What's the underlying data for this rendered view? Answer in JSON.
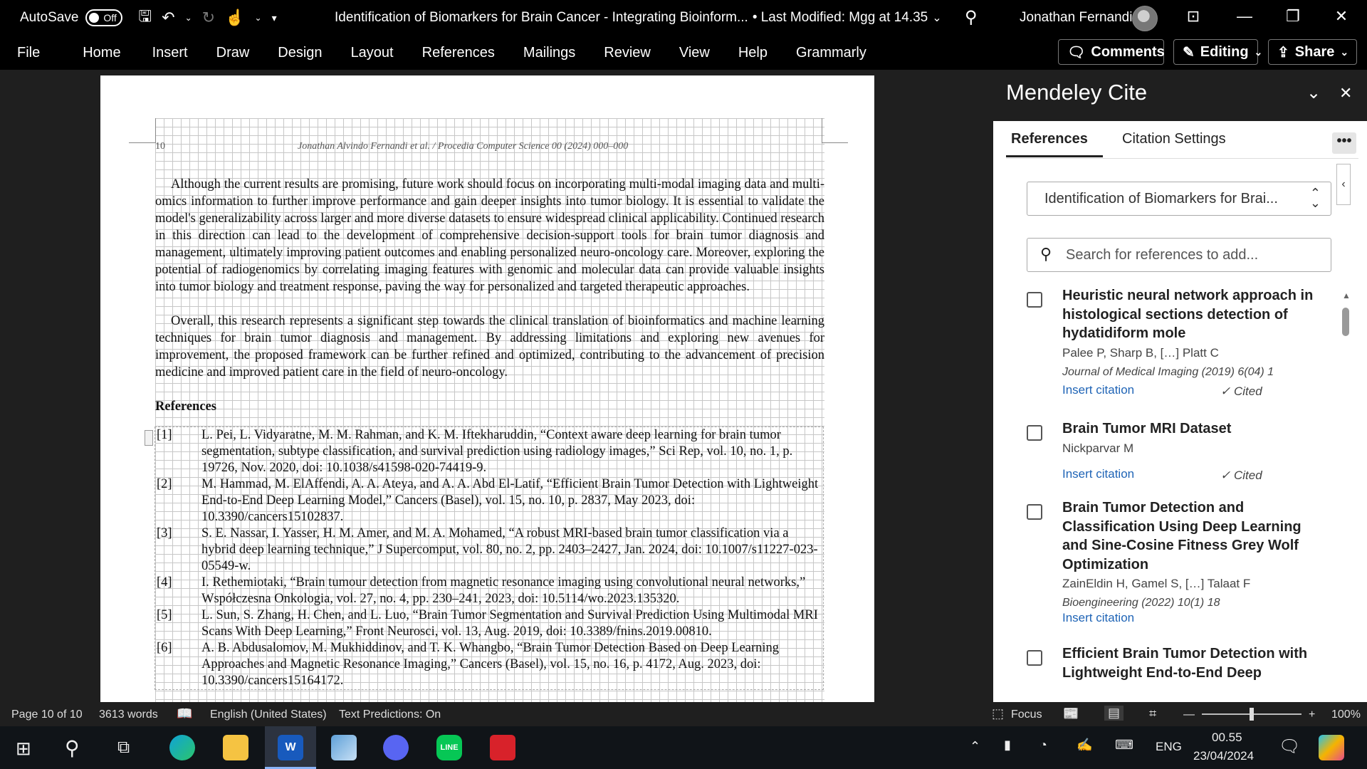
{
  "titlebar": {
    "autosave_label": "AutoSave",
    "autosave_state": "Off",
    "document_title": "Identification of Biomarkers for Brain Cancer - Integrating Bioinform...",
    "modified": "• Last Modified: Mgg at 14.35",
    "user": "Jonathan Fernandi"
  },
  "ribbon": {
    "tabs": [
      "File",
      "Home",
      "Insert",
      "Draw",
      "Design",
      "Layout",
      "References",
      "Mailings",
      "Review",
      "View",
      "Help",
      "Grammarly"
    ],
    "comments": "Comments",
    "editing": "Editing",
    "share": "Share"
  },
  "document": {
    "page_number": "10",
    "running_title": "Jonathan Alvindo Fernandi et al. / Procedia Computer Science 00 (2024) 000–000",
    "paragraph1": "Although the current results are promising, future work should focus on incorporating multi-modal imaging data and multi-omics information to further improve performance and gain deeper insights into tumor biology. It is essential to validate the model's generalizability across larger and more diverse datasets to ensure widespread clinical applicability. Continued research in this direction can lead to the development of comprehensive decision-support tools for brain tumor diagnosis and management, ultimately improving patient outcomes and enabling personalized neuro-oncology care. Moreover, exploring the potential of radiogenomics by correlating imaging features with genomic and molecular data can provide valuable insights into tumor biology and treatment response, paving the way for personalized and targeted therapeutic approaches.",
    "paragraph2": "Overall, this research represents a significant step towards the clinical translation of bioinformatics and machine learning techniques for brain tumor diagnosis and management. By addressing limitations and exploring new avenues for improvement, the proposed framework can be further refined and optimized, contributing to the advancement of precision medicine and improved patient care in the field of neuro-oncology.",
    "references_heading": "References",
    "references": [
      {
        "num": "[1]",
        "text": "L. Pei, L. Vidyaratne, M. M. Rahman, and K. M. Iftekharuddin, “Context aware deep learning for brain tumor segmentation, subtype classification, and survival prediction using radiology images,” Sci Rep, vol. 10, no. 1, p. 19726, Nov. 2020, doi: 10.1038/s41598-020-74419-9."
      },
      {
        "num": "[2]",
        "text": "M. Hammad, M. ElAffendi, A. A. Ateya, and A. A. Abd El-Latif, “Efficient Brain Tumor Detection with Lightweight End-to-End Deep Learning Model,” Cancers (Basel), vol. 15, no. 10, p. 2837, May 2023, doi: 10.3390/cancers15102837."
      },
      {
        "num": "[3]",
        "text": "S. E. Nassar, I. Yasser, H. M. Amer, and M. A. Mohamed, “A robust MRI-based brain tumor classification via a hybrid deep learning technique,” J Supercomput, vol. 80, no. 2, pp. 2403–2427, Jan. 2024, doi: 10.1007/s11227-023-05549-w."
      },
      {
        "num": "[4]",
        "text": "I. Rethemiotaki, “Brain tumour detection from magnetic resonance imaging using convolutional neural networks,” Współczesna Onkologia, vol. 27, no. 4, pp. 230–241, 2023, doi: 10.5114/wo.2023.135320."
      },
      {
        "num": "[5]",
        "text": "L. Sun, S. Zhang, H. Chen, and L. Luo, “Brain Tumor Segmentation and Survival Prediction Using Multimodal MRI Scans With Deep Learning,” Front Neurosci, vol. 13, Aug. 2019, doi: 10.3389/fnins.2019.00810."
      },
      {
        "num": "[6]",
        "text": "A. B. Abdusalomov, M. Mukhiddinov, and T. K. Whangbo, “Brain Tumor Detection Based on Deep Learning Approaches and Magnetic Resonance Imaging,” Cancers (Basel), vol. 15, no. 16, p. 4172, Aug. 2023, doi: 10.3390/cancers15164172."
      }
    ]
  },
  "mendeley": {
    "title": "Mendeley Cite",
    "tab_references": "References",
    "tab_settings": "Citation Settings",
    "more": "•••",
    "collection": "Identification of Biomarkers for Brai...",
    "search_placeholder": "Search for references to add...",
    "items": [
      {
        "title": "Heuristic neural network approach in histological sections detection of hydatidiform mole",
        "authors": "Palee P, Sharp B, […] Platt C",
        "journal": "Journal of Medical Imaging (2019) 6(04) 1",
        "action": "Insert citation",
        "status": "✓ Cited"
      },
      {
        "title": "Brain Tumor MRI Dataset",
        "authors": "Nickparvar M",
        "journal": "",
        "action": "Insert citation",
        "status": "✓ Cited"
      },
      {
        "title": "Brain Tumor Detection and Classification Using Deep Learning and Sine-Cosine Fitness Grey Wolf Optimization",
        "authors": "ZainEldin H, Gamel S, […] Talaat F",
        "journal": "Bioengineering (2022) 10(1) 18",
        "action": "Insert citation",
        "status": ""
      },
      {
        "title": "Efficient Brain Tumor Detection with Lightweight End-to-End Deep",
        "authors": "",
        "journal": "",
        "action": "",
        "status": ""
      }
    ]
  },
  "statusbar": {
    "page": "Page 10 of 10",
    "words": "3613 words",
    "language": "English (United States)",
    "predictions": "Text Predictions: On",
    "focus": "Focus",
    "zoom": "100%",
    "zoom_level": 1.0
  },
  "taskbar": {
    "language": "ENG",
    "time": "00.55",
    "date": "23/04/2024"
  },
  "colors": {
    "link": "#1f64b6",
    "dark_bg": "#1f1f1f",
    "word_blue": "#185abd"
  }
}
